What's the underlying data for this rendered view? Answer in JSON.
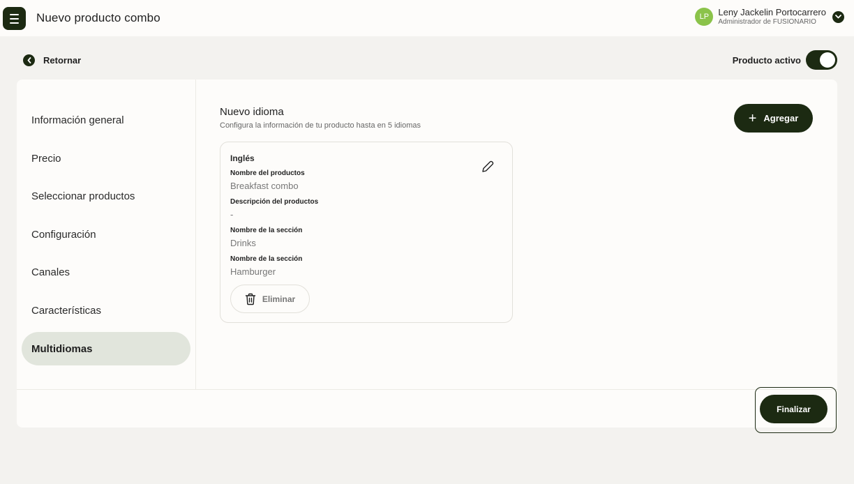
{
  "header": {
    "title": "Nuevo producto combo",
    "user": {
      "initials": "LP",
      "name": "Leny Jackelin Portocarrero",
      "role": "Administrador de FUSIONARIO"
    }
  },
  "back_label": "Retornar",
  "active_label": "Producto activo",
  "active_state": true,
  "sidebar": {
    "items": [
      {
        "label": "Información general"
      },
      {
        "label": "Precio"
      },
      {
        "label": "Seleccionar productos"
      },
      {
        "label": "Configuración"
      },
      {
        "label": "Canales"
      },
      {
        "label": "Características"
      },
      {
        "label": "Multidiomas"
      }
    ],
    "active_index": 6
  },
  "main": {
    "title": "Nuevo idioma",
    "subtitle": "Configura la información de tu producto hasta en 5 idiomas",
    "add_label": "Agregar",
    "language_card": {
      "language": "Inglés",
      "fields": [
        {
          "label": "Nombre del productos",
          "value": "Breakfast combo"
        },
        {
          "label": "Descripción del productos",
          "value": "-"
        },
        {
          "label": "Nombre de la sección",
          "value": "Drinks"
        },
        {
          "label": "Nombre de la sección",
          "value": "Hamburger"
        }
      ],
      "delete_label": "Eliminar"
    }
  },
  "footer": {
    "finish_label": "Finalizar"
  },
  "colors": {
    "primary": "#1c2a12",
    "avatar": "#8bc34a",
    "active_nav": "#e1e5dc",
    "background": "#f3f2ef"
  }
}
